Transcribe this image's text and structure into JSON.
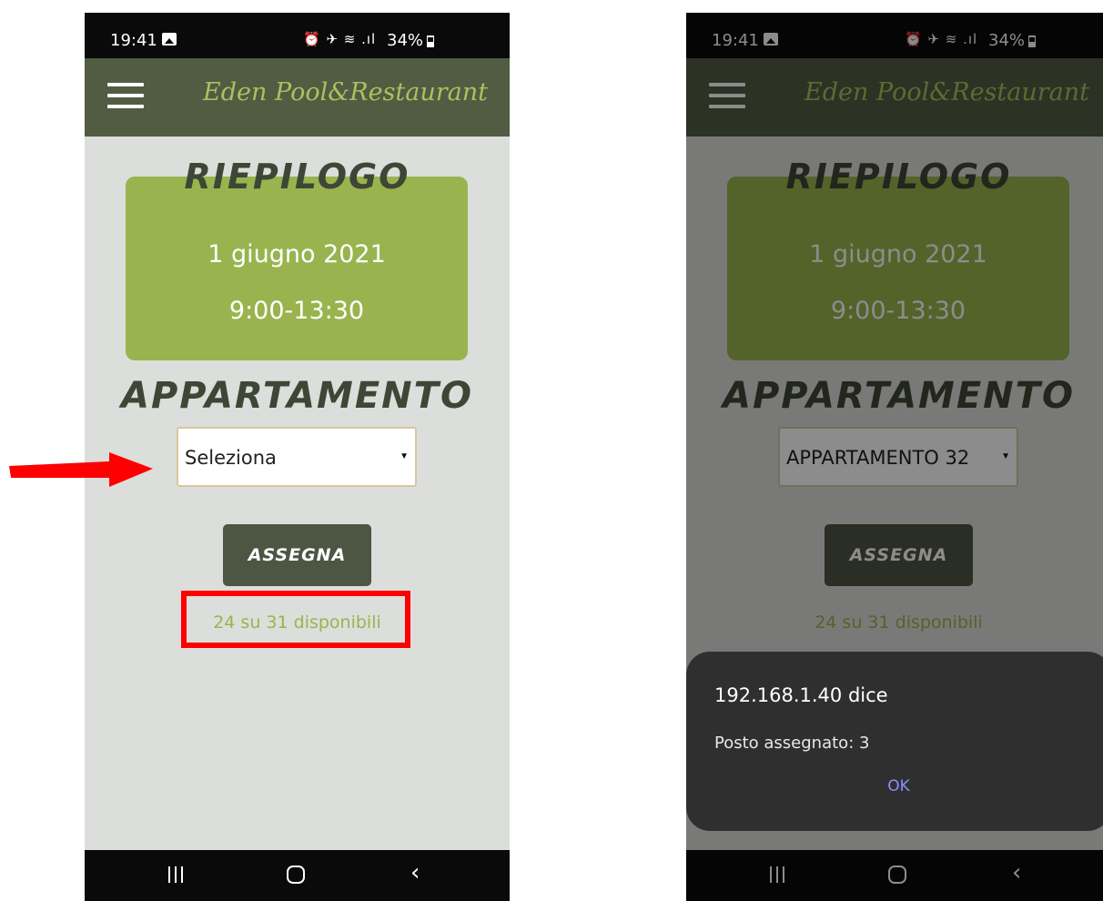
{
  "status_bar": {
    "time": "19:41",
    "icons_text": "⏰ ✈ ≋ .ıl",
    "battery": "34%"
  },
  "app": {
    "brand": "Eden Pool&Restaurant"
  },
  "summary": {
    "heading": "RIEPILOGO",
    "date": "1 giugno 2021",
    "hours": "9:00-13:30"
  },
  "apartment": {
    "heading": "APPARTAMENTO"
  },
  "left_screen": {
    "select_value": "Seleziona",
    "button_label": "ASSEGNA",
    "availability": "24 su 31 disponibili"
  },
  "right_screen": {
    "select_value": "APPARTAMENTO 32",
    "button_label": "ASSEGNA",
    "availability": "24 su 31 disponibili",
    "dialog": {
      "title": "192.168.1.40 dice",
      "message": "Posto assegnato: 3",
      "ok_label": "OK"
    }
  },
  "colors": {
    "appbar": "#515c43",
    "brand_text": "#a9c25e",
    "card": "#99b44e",
    "annotation": "#ff0000",
    "dialog_ok": "#8a8fff"
  },
  "icons": {
    "menu": "hamburger-icon",
    "dropdown": "caret-down-icon",
    "nav": [
      "recents-icon",
      "home-icon",
      "back-icon"
    ]
  }
}
